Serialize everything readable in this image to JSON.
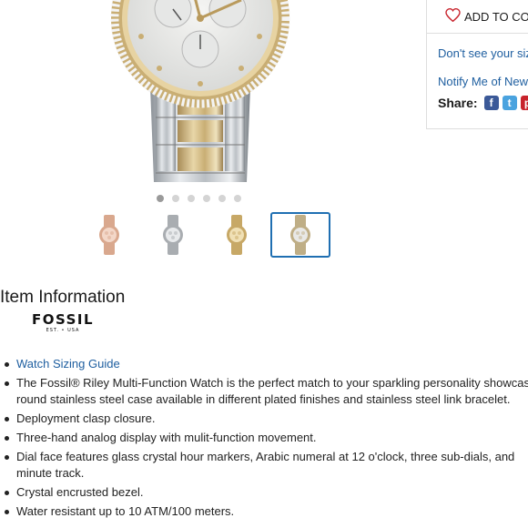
{
  "panel": {
    "add_to_collection": "ADD TO COLL",
    "dont_see_size": "Don't see your size",
    "notify_me": "Notify Me of New S",
    "share_label": "Share:",
    "share_icons": [
      "facebook-icon",
      "twitter-icon",
      "pinterest-icon"
    ],
    "fb_glyph": "f",
    "tw_glyph": "t",
    "pin_glyph": "p"
  },
  "gallery": {
    "dot_count": 6,
    "active_dot": 0,
    "thumbnails": [
      "rose-gold-watch",
      "silver-watch",
      "gold-watch",
      "two-tone-watch"
    ],
    "selected_thumbnail": 3
  },
  "item_info": {
    "title": "Item Information",
    "brand_name": "FOSSIL",
    "brand_sub": "EST. • USA",
    "bullets": [
      "Watch Sizing Guide",
      "The Fossil® Riley Multi-Function Watch is the perfect match to your sparkling personality showcasing a round stainless steel case available in different plated finishes and stainless steel link bracelet.",
      "Deployment clasp closure.",
      "Three-hand analog display with mulit-function movement.",
      "Dial face features glass crystal hour markers, Arabic numeral at 12 o'clock, three sub-dials, and minute track.",
      "Crystal encrusted bezel.",
      "Water resistant up to 10 ATM/100 meters."
    ]
  },
  "colors": {
    "link": "#1f5fa0",
    "selected_border": "#1f6fb2",
    "facebook": "#3b5998",
    "twitter": "#4aa3df",
    "pinterest": "#c8232c"
  }
}
